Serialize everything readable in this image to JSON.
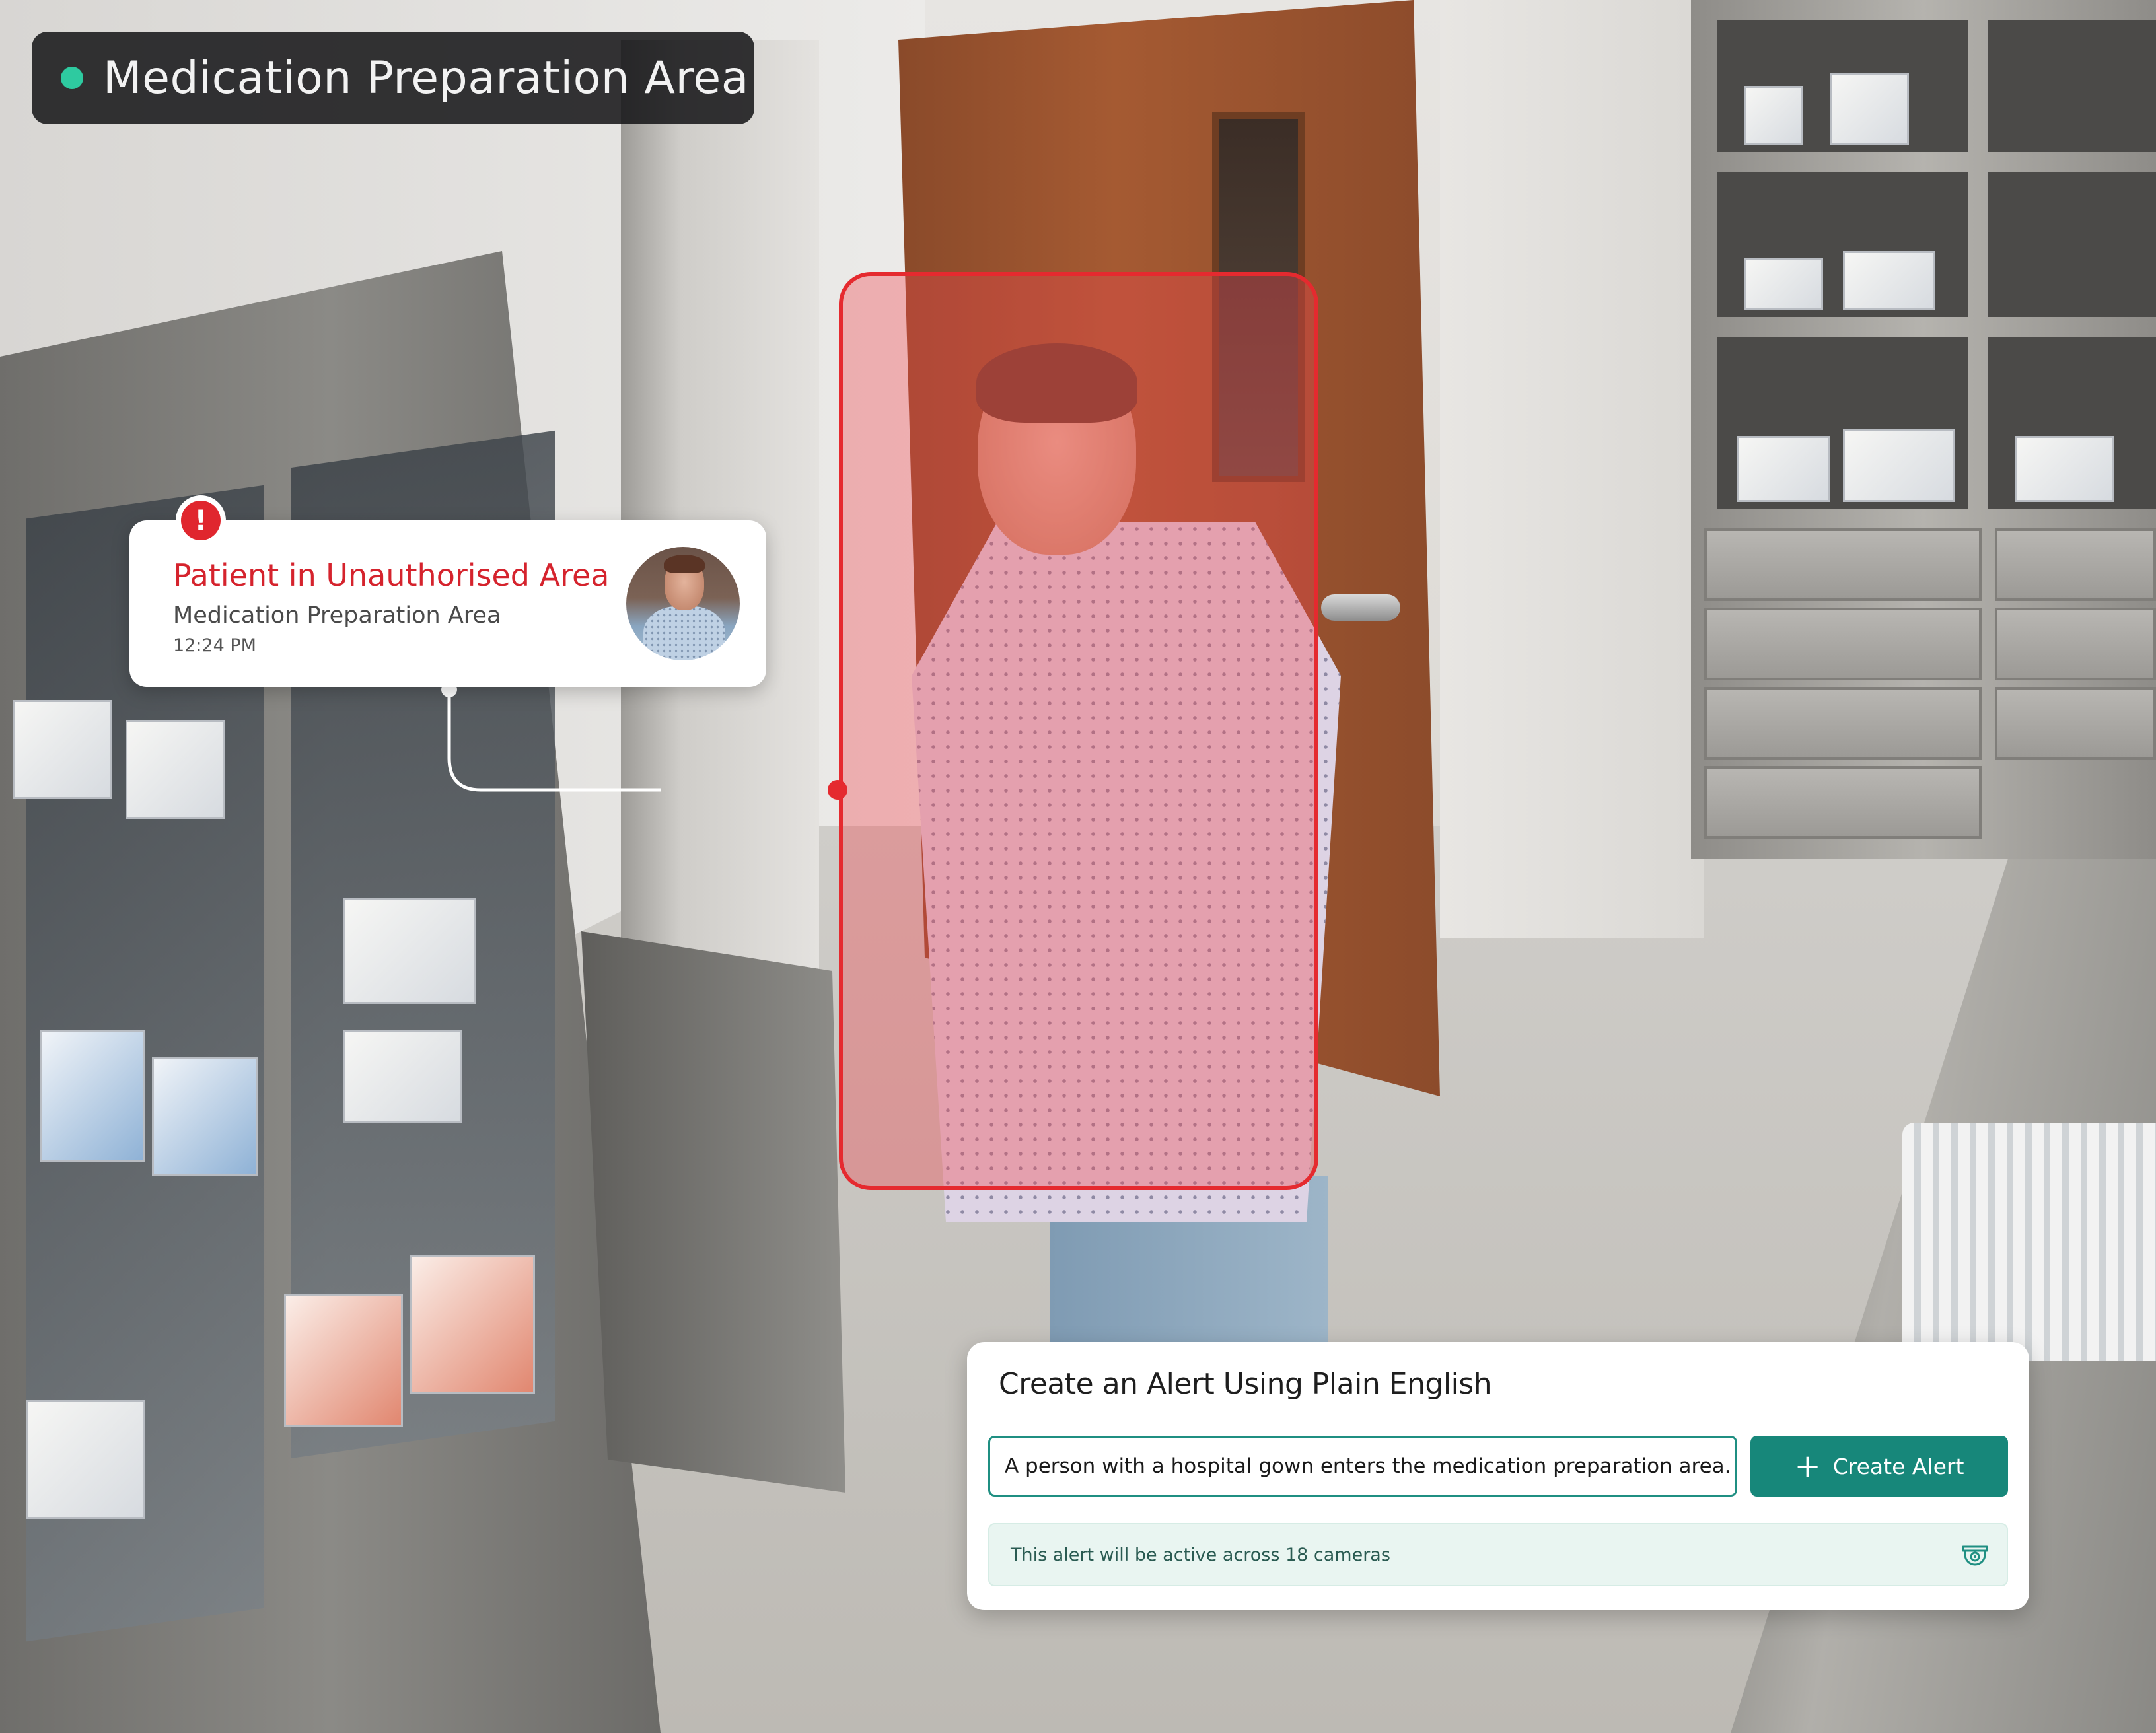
{
  "camera": {
    "location_label": "Medication Preparation Area",
    "status_color": "#2ecaa0"
  },
  "detection": {
    "box_color": "#e52a2f"
  },
  "alert_card": {
    "title": "Patient in Unauthorised Area",
    "location": "Medication Preparation Area",
    "time": "12:24 PM",
    "badge_icon": "exclamation-icon",
    "accent_color": "#d5232d"
  },
  "create_alert": {
    "title": "Create an Alert Using Plain English",
    "input_value": "A person with a hospital gown enters the medication preparation area.",
    "button_icon": "plus-icon",
    "button_label": "Create Alert",
    "info_text": "This alert will be active across 18 cameras",
    "info_icon": "security-camera-icon",
    "accent_color": "#17877a"
  }
}
